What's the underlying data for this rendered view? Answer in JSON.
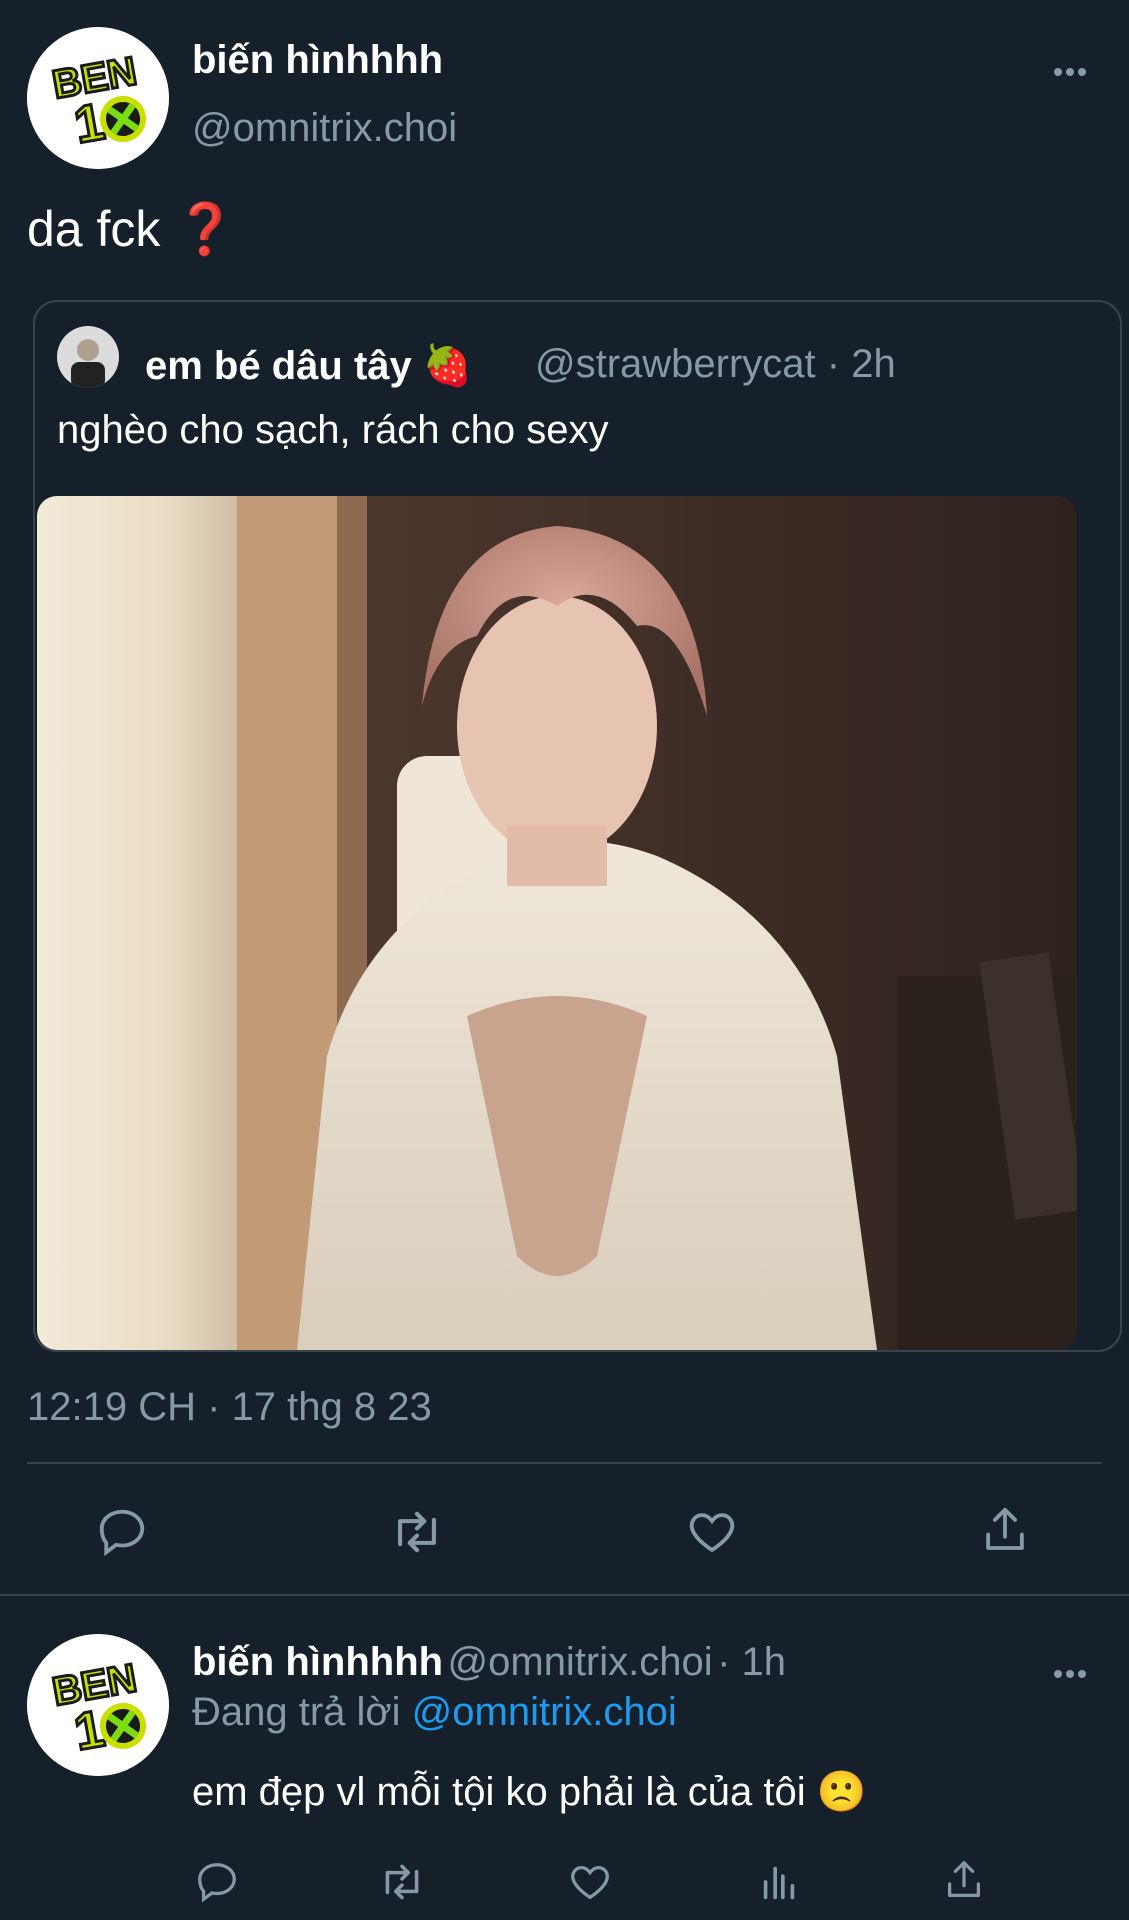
{
  "tweet": {
    "author_name": "biến hìnhhhh",
    "author_handle": "@omnitrix.choi",
    "avatar_text_top": "BEN",
    "avatar_text_bottom": "10",
    "text": "da fck",
    "text_emoji": "❓",
    "more_label": "•••",
    "timestamp": "12:19 CH · 17 thg 8 23"
  },
  "quote": {
    "author_name": "em bé dâu tây",
    "author_emoji": "🍓",
    "author_handle": "@strawberrycat",
    "time": "· 2h",
    "text": "nghèo cho sạch, rách cho sexy"
  },
  "actions": [
    "reply-icon",
    "retweet-icon",
    "like-icon",
    "share-icon"
  ],
  "reply": {
    "author_name": "biến hìnhhhh",
    "author_handle": "@omnitrix.choi",
    "time": "· 1h",
    "replying_to_label": "Đang trả lời",
    "replying_to_handle": "@omnitrix.choi",
    "text": "em đẹp vl mỗi tội ko phải là của tôi",
    "text_emoji": "🙁",
    "more_label": "•••",
    "actions": [
      "reply-icon",
      "retweet-icon",
      "like-icon",
      "views-icon",
      "share-icon"
    ]
  },
  "colors": {
    "background": "#15202b",
    "secondary_text": "#8899a6",
    "divider": "#38444d",
    "link": "#1d9bf0"
  }
}
